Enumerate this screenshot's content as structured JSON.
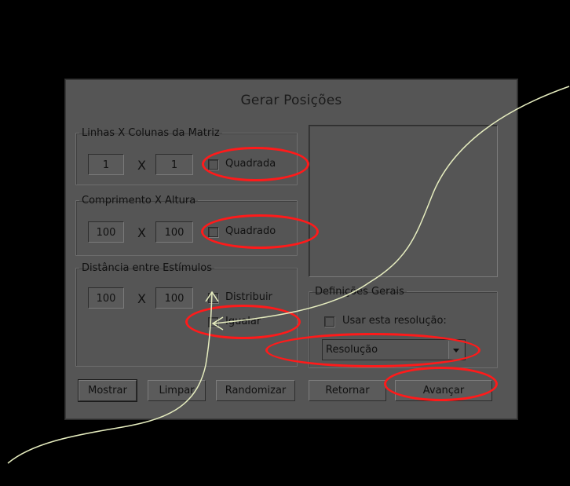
{
  "dialog": {
    "title": "Gerar Posições",
    "matrix": {
      "legend": "Linhas X Colunas da Matriz",
      "rows_value": "1",
      "x_label": "X",
      "cols_value": "1",
      "check_label": "Quadrada"
    },
    "size": {
      "legend": "Comprimento X Altura",
      "width_value": "100",
      "x_label": "X",
      "height_value": "100",
      "check_label": "Quadrado"
    },
    "distance": {
      "legend": "Distância entre Estímulos",
      "h_value": "100",
      "x_label": "X",
      "v_value": "100",
      "distribute_label": "Distribuir",
      "equalize_label": "Igualar"
    },
    "general": {
      "legend": "Definições Gerais",
      "use_resolution_label": "Usar esta resolução:",
      "resolution_selected": "Resolução"
    },
    "buttons": {
      "show": "Mostrar",
      "clear": "Limpar",
      "randomize": "Randomizar",
      "back": "Retornar",
      "next": "Avançar"
    }
  },
  "colors": {
    "dialog_bg": "#555555",
    "annotation_ring": "#ff1a1a",
    "annotation_curve": "#e6edbf"
  }
}
